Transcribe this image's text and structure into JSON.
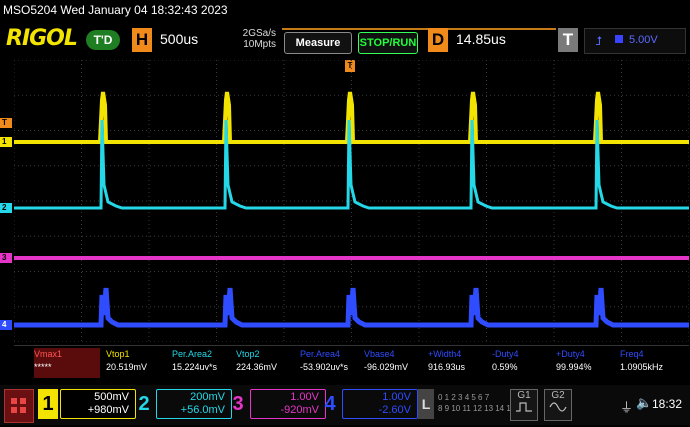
{
  "title_bar": "MSO5204  Wed January 04 18:32:43 2023",
  "toolbar": {
    "logo": "RIGOL",
    "trigger_state": "T'D",
    "horizontal_letter": "H",
    "timebase": "500us",
    "sample_rate": "2GSa/s",
    "memory_depth": "10Mpts",
    "measure_label": "Measure",
    "stoprun_label": "STOP/RUN",
    "delay_letter": "D",
    "delay_value": "14.85us",
    "trigger_letter": "T",
    "trigger_level": "5.00V"
  },
  "markers": {
    "trig_top": "T",
    "ch1_trig": "T",
    "ch1": "1",
    "ch2": "2",
    "ch3": "3",
    "ch4": "4"
  },
  "measurements": [
    {
      "label": "Vmax1",
      "value": "*****",
      "color": "#ff5555"
    },
    {
      "label": "Vtop1",
      "value": "20.519mV",
      "color": "#f2e300"
    },
    {
      "label": "Per.Area2",
      "value": "15.224uv*s",
      "color": "#25d8e8"
    },
    {
      "label": "Vtop2",
      "value": "224.36mV",
      "color": "#25d8e8"
    },
    {
      "label": "Per.Area4",
      "value": "-53.902uv*s",
      "color": "#2f4cff"
    },
    {
      "label": "Vbase4",
      "value": "-96.029mV",
      "color": "#2f4cff"
    },
    {
      "label": "+Width4",
      "value": "916.93us",
      "color": "#2f4cff"
    },
    {
      "label": "-Duty4",
      "value": "0.59%",
      "color": "#2f4cff"
    },
    {
      "label": "+Duty4",
      "value": "99.994%",
      "color": "#2f4cff"
    },
    {
      "label": "Freq4",
      "value": "1.0905kHz",
      "color": "#2f4cff"
    }
  ],
  "channels": [
    {
      "num": "1",
      "scale": "500mV",
      "offset": "+980mV",
      "color": "#f2e300",
      "active": true
    },
    {
      "num": "2",
      "scale": "200mV",
      "offset": "+56.0mV",
      "color": "#25d8e8",
      "active": false
    },
    {
      "num": "3",
      "scale": "1.00V",
      "offset": "-920mV",
      "color": "#e535c8",
      "active": false
    },
    {
      "num": "4",
      "scale": "1.00V",
      "offset": "-2.60V",
      "color": "#2f4cff",
      "active": false
    }
  ],
  "digital": {
    "letter": "L",
    "row1": "0 1 2 3  4 5 6 7",
    "row2": "8 9 10 11 12 13 14 15"
  },
  "gen1": "G1",
  "gen2": "G2",
  "clock": "18:32",
  "colors": {
    "ch1": "#f2e300",
    "ch2": "#25d8e8",
    "ch3": "#e535c8",
    "ch4": "#2f4cff",
    "trigger": "#f08a1a"
  }
}
